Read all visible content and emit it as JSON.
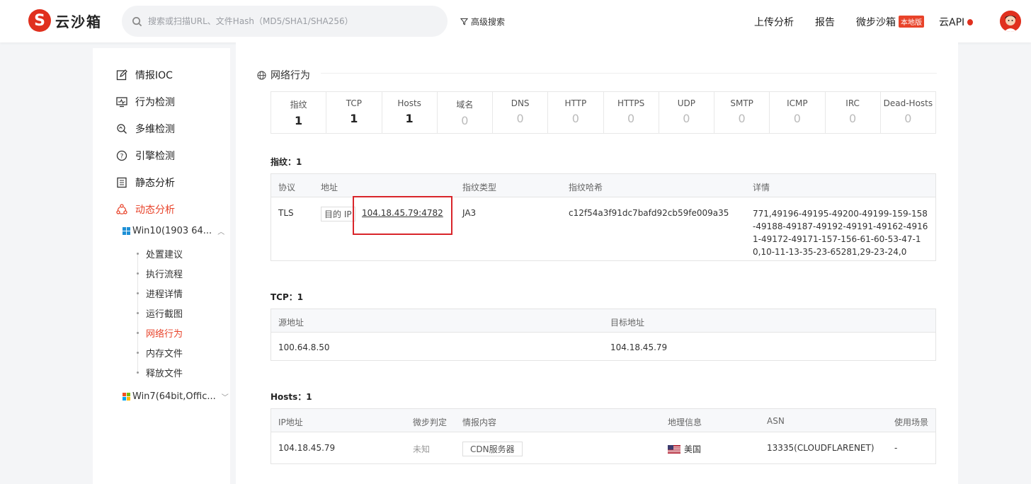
{
  "header": {
    "logo_text": "云沙箱",
    "logo_glyph": "S",
    "search_placeholder": "搜索或扫描URL、文件Hash（MD5/SHA1/SHA256）",
    "advanced_search": "高级搜索",
    "nav": {
      "upload": "上传分析",
      "report": "报告",
      "sandbox": "微步沙箱",
      "sandbox_badge": "本地版",
      "api": "云API"
    }
  },
  "sidebar": {
    "items": [
      {
        "label": "情报IOC",
        "icon": "edit-icon"
      },
      {
        "label": "行为检测",
        "icon": "monitor-icon"
      },
      {
        "label": "多维检测",
        "icon": "search-scan-icon"
      },
      {
        "label": "引擎检测",
        "icon": "question-circle-icon"
      },
      {
        "label": "静态分析",
        "icon": "list-doc-icon"
      },
      {
        "label": "动态分析",
        "icon": "cluster-icon"
      }
    ],
    "os1": "Win10(1903 64...",
    "os1_leaves": [
      "处置建议",
      "执行流程",
      "进程详情",
      "运行截图",
      "网络行为",
      "内存文件",
      "释放文件"
    ],
    "os2": "Win7(64bit,Offic...",
    "active_leaf": "网络行为"
  },
  "main": {
    "section_title": "网络行为",
    "stats": [
      {
        "label": "指纹",
        "value": "1"
      },
      {
        "label": "TCP",
        "value": "1"
      },
      {
        "label": "Hosts",
        "value": "1"
      },
      {
        "label": "域名",
        "value": "0"
      },
      {
        "label": "DNS",
        "value": "0"
      },
      {
        "label": "HTTP",
        "value": "0"
      },
      {
        "label": "HTTPS",
        "value": "0"
      },
      {
        "label": "UDP",
        "value": "0"
      },
      {
        "label": "SMTP",
        "value": "0"
      },
      {
        "label": "ICMP",
        "value": "0"
      },
      {
        "label": "IRC",
        "value": "0"
      },
      {
        "label": "Dead-Hosts",
        "value": "0"
      }
    ],
    "fingerprint": {
      "title": "指纹：1",
      "headers": {
        "protocol": "协议",
        "address": "地址",
        "fp_type": "指纹类型",
        "fp_hash": "指纹哈希",
        "detail": "详情"
      },
      "row": {
        "protocol": "TLS",
        "addr_tag": "目的 IP",
        "address": "104.18.45.79:4782",
        "fp_type": "JA3",
        "fp_hash": "c12f54a3f91dc7bafd92cb59fe009a35",
        "detail": "771,49196-49195-49200-49199-159-158-49188-49187-49192-49191-49162-49161-49172-49171-157-156-61-60-53-47-10,10-11-13-35-23-65281,29-23-24,0"
      }
    },
    "tcp": {
      "title": "TCP：1",
      "headers": {
        "src": "源地址",
        "dst": "目标地址"
      },
      "row": {
        "src": "100.64.8.50",
        "dst": "104.18.45.79"
      }
    },
    "hosts": {
      "title": "Hosts：1",
      "headers": {
        "ip": "IP地址",
        "judge": "微步判定",
        "intel": "情报内容",
        "geo": "地理信息",
        "asn": "ASN",
        "scene": "使用场景"
      },
      "row": {
        "ip": "104.18.45.79",
        "judge": "未知",
        "intel": "CDN服务器",
        "geo": "美国",
        "asn": "13335(CLOUDFLARENET)",
        "scene": "-"
      }
    }
  },
  "colors": {
    "accent": "#e8432a",
    "highlight_box": "#d9252a"
  }
}
